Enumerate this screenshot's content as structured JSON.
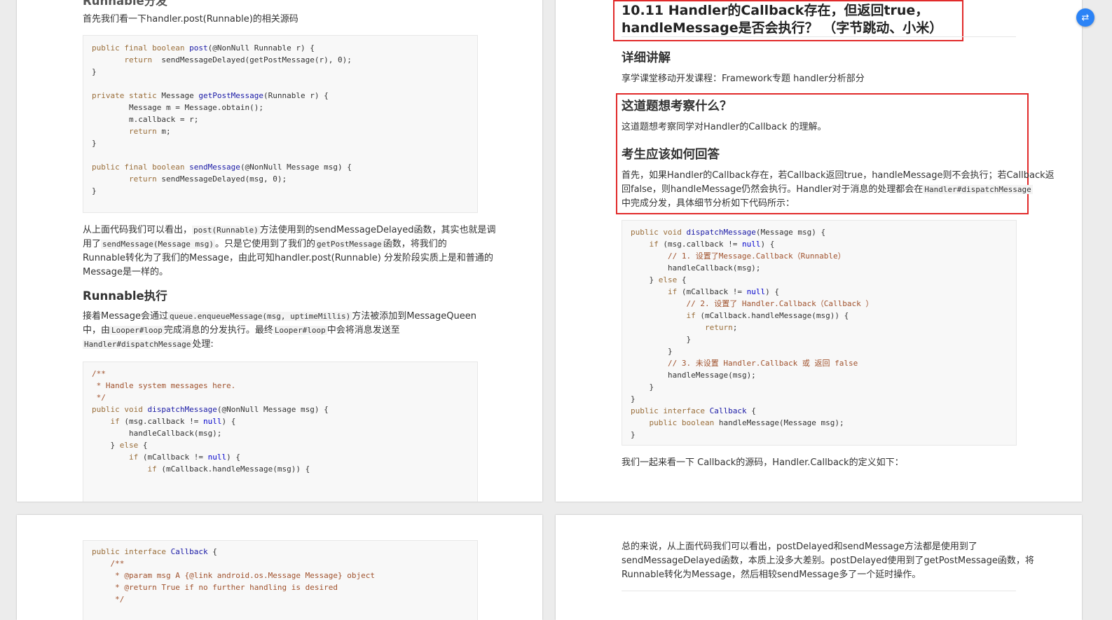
{
  "page1": {
    "heading_top": "Runnable分发",
    "intro": "首先我们看一下handler.post(Runnable)的相关源码",
    "code1": [
      "public final boolean post(@NonNull Runnable r) {",
      "       return  sendMessageDelayed(getPostMessage(r), 0);",
      "}",
      "",
      "private static Message getPostMessage(Runnable r) {",
      "        Message m = Message.obtain();",
      "        m.callback = r;",
      "        return m;",
      "}",
      "",
      "public final boolean sendMessage(@NonNull Message msg) {",
      "        return sendMessageDelayed(msg, 0);",
      "}"
    ],
    "para1_line1_a": "从上面代码我们可以看出，",
    "para1_line1_code": "post(Runnable)",
    "para1_line1_b": "方法使用到的sendMessageDelayed函数，其实也就是调",
    "para1_line2_a": "用了",
    "para1_line2_code1": "sendMessage(Message msg)",
    "para1_line2_b": "。只是它使用到了我们的",
    "para1_line2_code2": "getPostMessage",
    "para1_line2_c": "函数，将我们的",
    "para1_line3": "Runnable转化为了我们的Message，由此可知handler.post(Runnable) 分发阶段实质上是和普通的",
    "para1_line4": "Message是一样的。",
    "heading_runnable": "Runnable执行",
    "para2_line1_a": "接着Message会通过",
    "para2_line1_code": "queue.enqueueMessage(msg, uptimeMillis)",
    "para2_line1_b": "方法被添加到MessageQueen",
    "para2_line2_a": "中，由",
    "para2_line2_code1": "Looper#loop",
    "para2_line2_b": "完成消息的分发执行。最终",
    "para2_line2_code2": "Looper#loop",
    "para2_line2_c": "中会将消息发送至",
    "para2_line3_code": "Handler#dispatchMessage",
    "para2_line3_b": "处理:",
    "code2": [
      "/**",
      " * Handle system messages here.",
      " */",
      "public void dispatchMessage(@NonNull Message msg) {",
      "    if (msg.callback != null) {",
      "        handleCallback(msg);",
      "    } else {",
      "        if (mCallback != null) {",
      "            if (mCallback.handleMessage(msg)) {"
    ]
  },
  "page2": {
    "title_line1": "10.11 Handler的Callback存在，但返回true，",
    "title_line2": "handleMessage是否会执行？ （字节跳动、小米）",
    "heading_detail": "详细讲解",
    "detail_text": "享学课堂移动开发课程：Framework专题 handler分析部分",
    "heading_q": "这道题想考察什么？",
    "q_text": "这道题想考察同学对Handler的Callback 的理解。",
    "heading_a": "考生应该如何回答",
    "a_line1": "首先，如果Handler的Callback存在，若Callback返回true，handleMessage则不会执行；若Callback返",
    "a_line2_a": "回false，则handleMessage仍然会执行。Handler对于消息的处理都会在",
    "a_line2_code": "Handler#dispatchMessage",
    "a_line3": "中完成分发，具体细节分析如下代码所示：",
    "code3": [
      "public void dispatchMessage(Message msg) {",
      "    if (msg.callback != null) {",
      "        // 1. 设置了Message.Callback（Runnable）",
      "        handleCallback(msg);",
      "    } else {",
      "        if (mCallback != null) {",
      "            // 2. 设置了 Handler.Callback（Callback ）",
      "            if (mCallback.handleMessage(msg)) {",
      "                return;",
      "            }",
      "        }",
      "        // 3. 未设置 Handler.Callback 或 返回 false",
      "        handleMessage(msg);",
      "    }",
      "}",
      "public interface Callback {",
      "    public boolean handleMessage(Message msg);",
      "}"
    ],
    "after_code": "我们一起来看一下 Callback的源码，Handler.Callback的定义如下："
  },
  "page3": {
    "code4": [
      "public interface Callback {",
      "    /**",
      "     * @param msg A {@link android.os.Message Message} object",
      "     * @return True if no further handling is desired",
      "     */"
    ]
  },
  "page4": {
    "line1": "总的来说，从上面代码我们可以看出，postDelayed和sendMessage方法都是使用到了",
    "line2": "sendMessageDelayed函数，本质上没多大差别。postDelayed使用到了getPostMessage函数，将",
    "line3": "Runnable转化为Message，然后相较sendMessage多了一个延时操作。"
  },
  "floating": {
    "icon": "translate-icon",
    "glyph": "⇄"
  },
  "colors": {
    "highlight": "#e12a2a",
    "accent": "#2b83f6"
  }
}
